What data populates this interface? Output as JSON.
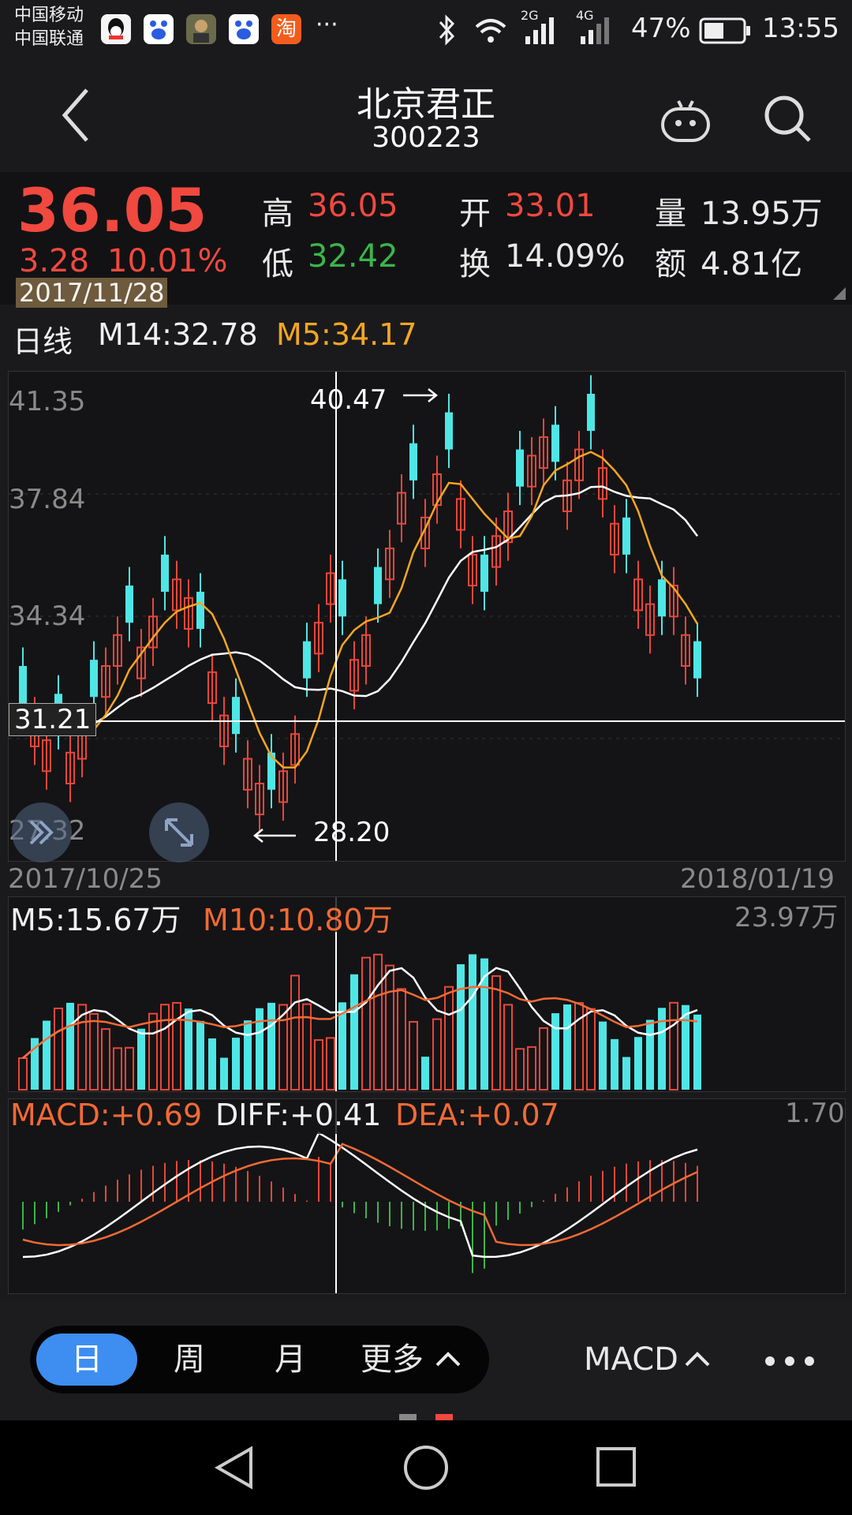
{
  "status_bar": {
    "carrier1": "中国移动",
    "carrier2": "中国联通",
    "more_dots": "···",
    "net_2g": "2G",
    "net_4g": "4G",
    "battery": "47%",
    "time": "13:55",
    "app_taobao": "淘"
  },
  "nav": {
    "title": "北京君正",
    "code": "300223"
  },
  "quote": {
    "price": "36.05",
    "change": "3.28",
    "change_pct": "10.01%",
    "date": "2017/11/28",
    "high_label": "高",
    "high": "36.05",
    "low_label": "低",
    "low": "32.42",
    "open_label": "开",
    "open": "33.01",
    "turnover_label": "换",
    "turnover": "14.09%",
    "volume_label": "量",
    "volume": "13.95万",
    "amount_label": "额",
    "amount": "4.81亿"
  },
  "kline": {
    "period_label": "日线",
    "ma14": "M14:32.78",
    "ma5": "M5:34.17",
    "y_top": "41.35",
    "y_2": "37.84",
    "y_3": "34.34",
    "y_bottom": "27.32",
    "crosshair_price": "31.21",
    "max_marker": "40.47",
    "min_marker": "28.20",
    "date_start": "2017/10/25",
    "date_end": "2018/01/19",
    "colors": {
      "up": "#e8473a",
      "down": "#4fe6e6",
      "ma5": "#f5a623",
      "ma14": "#ffffff"
    }
  },
  "volume": {
    "m5": "M5:15.67万",
    "m10": "M10:10.80万",
    "max": "23.97万"
  },
  "macd": {
    "macd": "MACD:+0.69",
    "diff": "DIFF:+0.41",
    "dea": "DEA:+0.07",
    "max": "1.70"
  },
  "bottom": {
    "tab_day": "日",
    "tab_week": "周",
    "tab_month": "月",
    "tab_more": "更多",
    "indicator": "MACD"
  }
}
